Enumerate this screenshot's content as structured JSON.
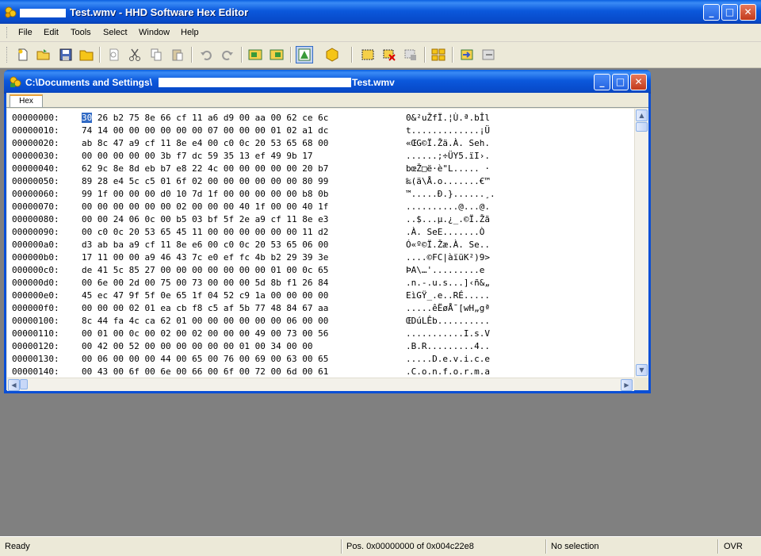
{
  "window": {
    "title": "Test.wmv - HHD Software Hex Editor",
    "minimize_glyph": "_",
    "maximize_glyph": "□",
    "close_glyph": "✕"
  },
  "menu": [
    "File",
    "Edit",
    "Tools",
    "Select",
    "Window",
    "Help"
  ],
  "toolbar_icons": [
    "new-icon",
    "open-icon",
    "save-icon",
    "open-folder-icon",
    "find-icon",
    "cut-icon",
    "copy-icon",
    "paste-icon",
    "undo-icon",
    "redo-icon",
    "bookmark-icon",
    "bookmark-list-icon",
    "structure-icon",
    "hexagon-icon",
    "select-block-icon",
    "delete-selection-icon",
    "fill-icon",
    "compare-icon",
    "import-icon",
    "export-icon"
  ],
  "document": {
    "path_prefix": "C:\\Documents and Settings\\",
    "file_name": "Test.wmv",
    "tab_label": "Hex",
    "rows": [
      {
        "addr": "00000000:",
        "bytes": [
          "30",
          "26",
          "b2",
          "75",
          "8e",
          "66",
          "cf",
          "11",
          "a6",
          "d9",
          "00",
          "aa",
          "00",
          "62",
          "ce",
          "6c"
        ],
        "ascii": "0&²uŽfÏ.¦Ù.ª.bÎl"
      },
      {
        "addr": "00000010:",
        "bytes": [
          "74",
          "14",
          "00",
          "00",
          "00",
          "00",
          "00",
          "00",
          "07",
          "00",
          "00",
          "00",
          "01",
          "02",
          "a1",
          "dc"
        ],
        "ascii": "t.............¡Ü"
      },
      {
        "addr": "00000020:",
        "bytes": [
          "ab",
          "8c",
          "47",
          "a9",
          "cf",
          "11",
          "8e",
          "e4",
          "00",
          "c0",
          "0c",
          "20",
          "53",
          "65",
          "68",
          "00"
        ],
        "ascii": "«ŒG©Ï.Žä.À. Seh."
      },
      {
        "addr": "00000030:",
        "bytes": [
          "00",
          "00",
          "00",
          "00",
          "00",
          "3b",
          "f7",
          "dc",
          "59",
          "35",
          "13",
          "ef",
          "49",
          "9b",
          "17"
        ],
        "ascii": "......;÷ÜY5.ïI›."
      },
      {
        "addr": "00000040:",
        "bytes": [
          "62",
          "9c",
          "8e",
          "8d",
          "eb",
          "b7",
          "e8",
          "22",
          "4c",
          "00",
          "00",
          "00",
          "00",
          "00",
          "20",
          "b7"
        ],
        "ascii": "bœŽ□ë·è\"L..... ·"
      },
      {
        "addr": "00000050:",
        "bytes": [
          "89",
          "28",
          "e4",
          "5c",
          "c5",
          "01",
          "6f",
          "02",
          "00",
          "00",
          "00",
          "00",
          "00",
          "00",
          "80",
          "99"
        ],
        "ascii": "‰(ä\\Å.o.......€™"
      },
      {
        "addr": "00000060:",
        "bytes": [
          "99",
          "1f",
          "00",
          "00",
          "00",
          "d0",
          "10",
          "7d",
          "1f",
          "00",
          "00",
          "00",
          "00",
          "00",
          "b8",
          "0b"
        ],
        "ascii": "™.....Ð.}......¸."
      },
      {
        "addr": "00000070:",
        "bytes": [
          "00",
          "00",
          "00",
          "00",
          "00",
          "00",
          "02",
          "00",
          "00",
          "00",
          "40",
          "1f",
          "00",
          "00",
          "40",
          "1f"
        ],
        "ascii": "..........@...@."
      },
      {
        "addr": "00000080:",
        "bytes": [
          "00",
          "00",
          "24",
          "06",
          "0c",
          "00",
          "b5",
          "03",
          "bf",
          "5f",
          "2e",
          "a9",
          "cf",
          "11",
          "8e",
          "e3"
        ],
        "ascii": "..$...µ.¿_.©Ï.Žã"
      },
      {
        "addr": "00000090:",
        "bytes": [
          "00",
          "c0",
          "0c",
          "20",
          "53",
          "65",
          "45",
          "11",
          "00",
          "00",
          "00",
          "00",
          "00",
          "00",
          "11",
          "d2"
        ],
        "ascii": ".À. SeE.......Ò"
      },
      {
        "addr": "000000a0:",
        "bytes": [
          "d3",
          "ab",
          "ba",
          "a9",
          "cf",
          "11",
          "8e",
          "e6",
          "00",
          "c0",
          "0c",
          "20",
          "53",
          "65",
          "06",
          "00"
        ],
        "ascii": "Ó«º©Ï.Žæ.À. Se.."
      },
      {
        "addr": "000000b0:",
        "bytes": [
          "17",
          "11",
          "00",
          "00",
          "a9",
          "46",
          "43",
          "7c",
          "e0",
          "ef",
          "fc",
          "4b",
          "b2",
          "29",
          "39",
          "3e"
        ],
        "ascii": "....©FC|àïüK²)9>"
      },
      {
        "addr": "000000c0:",
        "bytes": [
          "de",
          "41",
          "5c",
          "85",
          "27",
          "00",
          "00",
          "00",
          "00",
          "00",
          "00",
          "00",
          "01",
          "00",
          "0c",
          "65"
        ],
        "ascii": "ÞA\\…'.........e"
      },
      {
        "addr": "000000d0:",
        "bytes": [
          "00",
          "6e",
          "00",
          "2d",
          "00",
          "75",
          "00",
          "73",
          "00",
          "00",
          "00",
          "5d",
          "8b",
          "f1",
          "26",
          "84"
        ],
        "ascii": ".n.-.u.s...]‹ñ&„"
      },
      {
        "addr": "000000e0:",
        "bytes": [
          "45",
          "ec",
          "47",
          "9f",
          "5f",
          "0e",
          "65",
          "1f",
          "04",
          "52",
          "c9",
          "1a",
          "00",
          "00",
          "00",
          "00"
        ],
        "ascii": "EìGŸ_.e..RÉ....."
      },
      {
        "addr": "000000f0:",
        "bytes": [
          "00",
          "00",
          "00",
          "02",
          "01",
          "ea",
          "cb",
          "f8",
          "c5",
          "af",
          "5b",
          "77",
          "48",
          "84",
          "67",
          "aa"
        ],
        "ascii": ".....êËøÅ¯[wH„gª"
      },
      {
        "addr": "00000100:",
        "bytes": [
          "8c",
          "44",
          "fa",
          "4c",
          "ca",
          "62",
          "01",
          "00",
          "00",
          "00",
          "00",
          "00",
          "00",
          "06",
          "00",
          "00"
        ],
        "ascii": "ŒDúLÊb.........."
      },
      {
        "addr": "00000110:",
        "bytes": [
          "00",
          "01",
          "00",
          "0c",
          "00",
          "02",
          "00",
          "02",
          "00",
          "00",
          "00",
          "49",
          "00",
          "73",
          "00",
          "56"
        ],
        "ascii": "...........I.s.V"
      },
      {
        "addr": "00000120:",
        "bytes": [
          "00",
          "42",
          "00",
          "52",
          "00",
          "00",
          "00",
          "00",
          "00",
          "00",
          "01",
          "00",
          "34",
          "00",
          "00"
        ],
        "ascii": ".B.R.........4.."
      },
      {
        "addr": "00000130:",
        "bytes": [
          "00",
          "06",
          "00",
          "00",
          "00",
          "44",
          "00",
          "65",
          "00",
          "76",
          "00",
          "69",
          "00",
          "63",
          "00",
          "65"
        ],
        "ascii": ".....D.e.v.i.c.e"
      },
      {
        "addr": "00000140:",
        "bytes": [
          "00",
          "43",
          "00",
          "6f",
          "00",
          "6e",
          "00",
          "66",
          "00",
          "6f",
          "00",
          "72",
          "00",
          "6d",
          "00",
          "61"
        ],
        "ascii": ".C.o.n.f.o.r.m.a"
      }
    ]
  },
  "status": {
    "state": "Ready",
    "position": "Pos. 0x00000000 of 0x004c22e8",
    "selection": "No selection",
    "mode": "OVR"
  }
}
